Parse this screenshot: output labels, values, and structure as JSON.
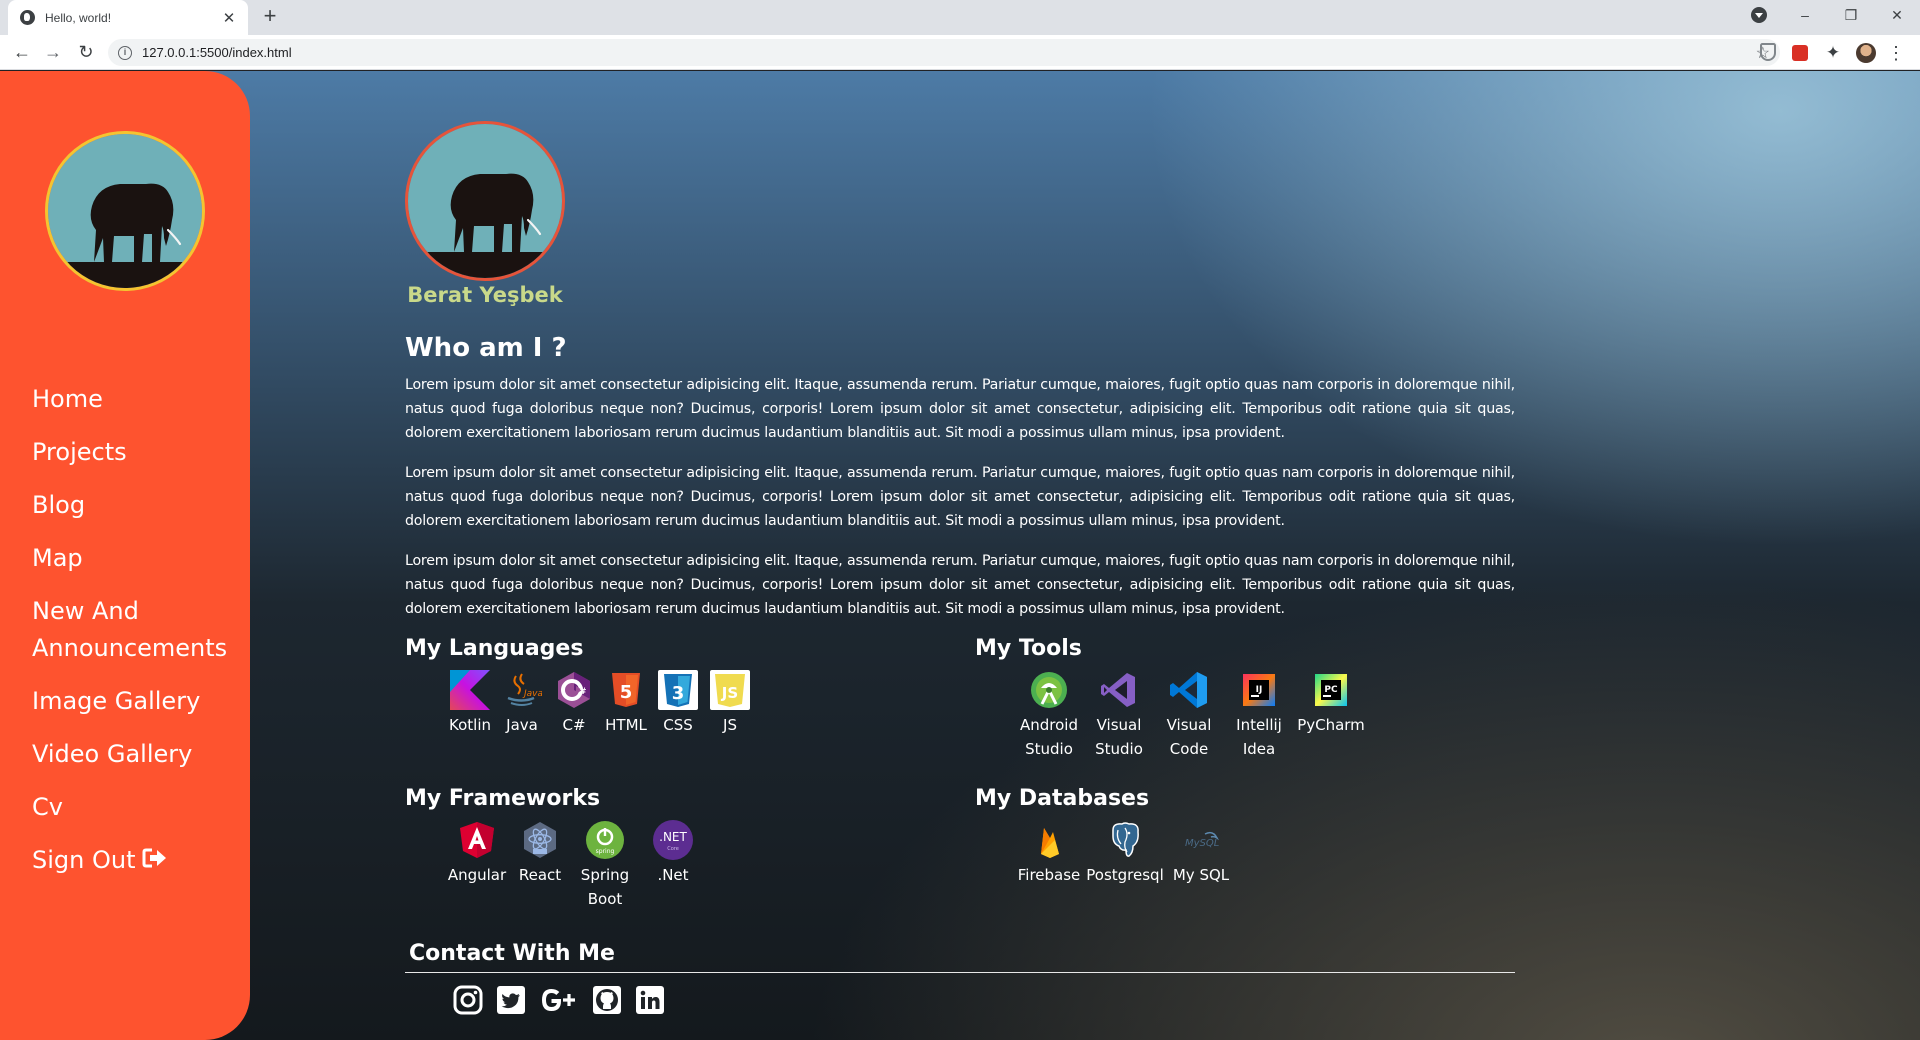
{
  "browser": {
    "tab_title": "Hello, world!",
    "url": "127.0.0.1:5500/index.html"
  },
  "sidebar": {
    "nav": [
      {
        "label": "Home"
      },
      {
        "label": "Projects"
      },
      {
        "label": "Blog"
      },
      {
        "label": "Map"
      },
      {
        "label": "New And Announcements"
      },
      {
        "label": "Image Gallery"
      },
      {
        "label": "Video Gallery"
      },
      {
        "label": "Cv"
      },
      {
        "label": "Sign Out",
        "icon": "sign-out-icon"
      }
    ]
  },
  "profile": {
    "name": "Berat Yeşbek"
  },
  "about": {
    "title": "Who am I ?",
    "paragraphs": [
      "Lorem ipsum dolor sit amet consectetur adipisicing elit. Itaque, assumenda rerum. Pariatur cumque, maiores, fugit optio quas nam corporis in doloremque nihil, natus quod fuga doloribus neque non? Ducimus, corporis! Lorem ipsum dolor sit amet consectetur, adipisicing elit. Temporibus odit ratione quia sit quas, dolorem exercitationem laboriosam rerum ducimus laudantium blanditiis aut. Sit modi a possimus ullam minus, ipsa provident.",
      "Lorem ipsum dolor sit amet consectetur adipisicing elit. Itaque, assumenda rerum. Pariatur cumque, maiores, fugit optio quas nam corporis in doloremque nihil, natus quod fuga doloribus neque non? Ducimus, corporis! Lorem ipsum dolor sit amet consectetur, adipisicing elit. Temporibus odit ratione quia sit quas, dolorem exercitationem laboriosam rerum ducimus laudantium blanditiis aut. Sit modi a possimus ullam minus, ipsa provident.",
      "Lorem ipsum dolor sit amet consectetur adipisicing elit. Itaque, assumenda rerum. Pariatur cumque, maiores, fugit optio quas nam corporis in doloremque nihil, natus quod fuga doloribus neque non? Ducimus, corporis! Lorem ipsum dolor sit amet consectetur, adipisicing elit. Temporibus odit ratione quia sit quas, dolorem exercitationem laboriosam rerum ducimus laudantium blanditiis aut. Sit modi a possimus ullam minus, ipsa provident."
    ]
  },
  "languages": {
    "title": "My Languages",
    "items": [
      {
        "label": "Kotlin",
        "icon": "kotlin-icon"
      },
      {
        "label": "Java",
        "icon": "java-icon"
      },
      {
        "label": "C#",
        "icon": "csharp-icon"
      },
      {
        "label": "HTML",
        "icon": "html5-icon"
      },
      {
        "label": "CSS",
        "icon": "css3-icon"
      },
      {
        "label": "JS",
        "icon": "javascript-icon"
      }
    ]
  },
  "tools": {
    "title": "My Tools",
    "items": [
      {
        "label": "Android Studio",
        "icon": "android-studio-icon"
      },
      {
        "label": "Visual Studio",
        "icon": "visual-studio-icon"
      },
      {
        "label": "Visual Code",
        "icon": "vscode-icon"
      },
      {
        "label": "Intellij Idea",
        "icon": "intellij-icon"
      },
      {
        "label": "PyCharm",
        "icon": "pycharm-icon"
      }
    ]
  },
  "frameworks": {
    "title": "My Frameworks",
    "items": [
      {
        "label": "Angular",
        "icon": "angular-icon"
      },
      {
        "label": "React",
        "icon": "react-icon"
      },
      {
        "label": "Spring Boot",
        "icon": "spring-icon"
      },
      {
        "label": ".Net",
        "icon": "dotnet-icon"
      }
    ]
  },
  "databases": {
    "title": "My Databases",
    "items": [
      {
        "label": "Firebase",
        "icon": "firebase-icon"
      },
      {
        "label": "Postgresql",
        "icon": "postgresql-icon"
      },
      {
        "label": "My SQL",
        "icon": "mysql-icon"
      }
    ]
  },
  "contact": {
    "title": "Contact With Me",
    "links": [
      {
        "icon": "instagram-icon"
      },
      {
        "icon": "twitter-icon"
      },
      {
        "icon": "google-plus-icon"
      },
      {
        "icon": "github-icon"
      },
      {
        "icon": "linkedin-icon"
      }
    ]
  },
  "colors": {
    "sidebar": "#fe532f",
    "name_accent": "#c9d98a",
    "avatar_sky": "#6fb0b8"
  }
}
